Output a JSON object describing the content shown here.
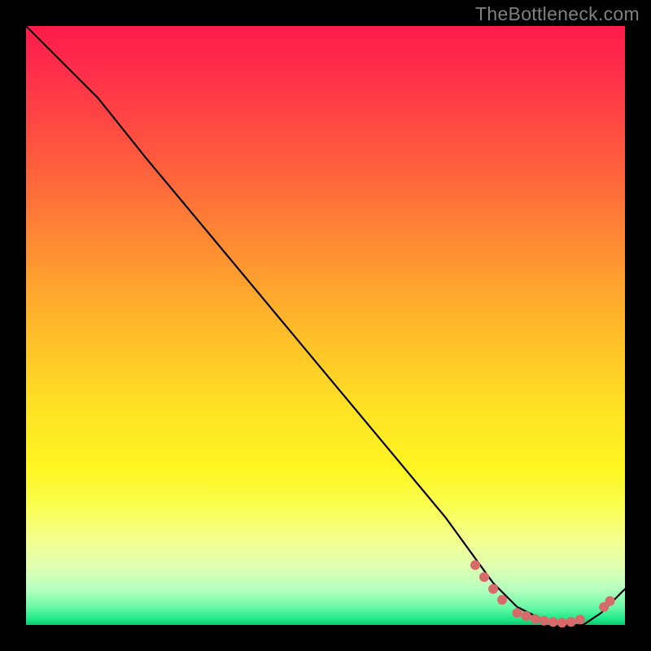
{
  "watermark": "TheBottleneck.com",
  "chart_data": {
    "type": "line",
    "title": "",
    "xlabel": "",
    "ylabel": "",
    "xlim": [
      0,
      100
    ],
    "ylim": [
      0,
      100
    ],
    "series": [
      {
        "name": "curve",
        "x": [
          0,
          3,
          7,
          12,
          20,
          30,
          40,
          50,
          60,
          70,
          78,
          82,
          86,
          90,
          93,
          96,
          100
        ],
        "values": [
          100,
          97,
          93,
          88,
          78,
          66,
          54,
          42,
          30,
          18,
          7,
          3,
          1,
          0,
          0,
          2,
          6
        ]
      }
    ],
    "markers": {
      "name": "dots",
      "color": "#d96a6a",
      "points": [
        {
          "x": 75.0,
          "y": 10.0
        },
        {
          "x": 76.5,
          "y": 8.0
        },
        {
          "x": 78.0,
          "y": 6.0
        },
        {
          "x": 79.5,
          "y": 4.2
        },
        {
          "x": 82.0,
          "y": 2.0
        },
        {
          "x": 83.5,
          "y": 1.5
        },
        {
          "x": 85.0,
          "y": 1.0
        },
        {
          "x": 86.5,
          "y": 0.7
        },
        {
          "x": 88.0,
          "y": 0.5
        },
        {
          "x": 89.5,
          "y": 0.4
        },
        {
          "x": 91.0,
          "y": 0.5
        },
        {
          "x": 92.5,
          "y": 0.9
        },
        {
          "x": 96.5,
          "y": 3.0
        },
        {
          "x": 97.5,
          "y": 4.0
        }
      ]
    },
    "gradient_stops": [
      {
        "pos": 0.0,
        "color": "#ff1b4a"
      },
      {
        "pos": 0.5,
        "color": "#ffe324"
      },
      {
        "pos": 0.85,
        "color": "#f4ff86"
      },
      {
        "pos": 1.0,
        "color": "#06c869"
      }
    ]
  }
}
